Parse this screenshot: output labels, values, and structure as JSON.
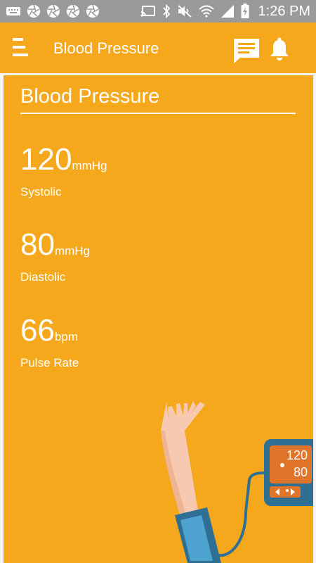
{
  "status_bar": {
    "time": "1:26 PM"
  },
  "app_bar": {
    "title": "Blood Pressure",
    "icons": [
      "menu-icon",
      "chat-icon",
      "bell-icon"
    ]
  },
  "card": {
    "title": "Blood Pressure",
    "readings": [
      {
        "value": "120",
        "unit": "mmHg",
        "label": "Systolic"
      },
      {
        "value": "80",
        "unit": "mmHg",
        "label": "Diastolic"
      },
      {
        "value": "66",
        "unit": "bpm",
        "label": "Pulse Rate"
      }
    ],
    "monitor": {
      "top_value": "120",
      "bottom_value": "80"
    }
  },
  "colors": {
    "accent": "#f5a81b",
    "status_bar": "#9a9a9a",
    "background": "#f5f5f5",
    "monitor_body": "#2e6f93",
    "monitor_screen": "#e0742b"
  }
}
